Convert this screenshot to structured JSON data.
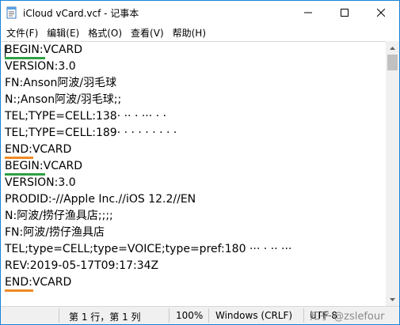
{
  "window": {
    "title": "iCloud vCard.vcf - 记事本"
  },
  "menu": [
    "文件(F)",
    "编辑(E)",
    "格式(O)",
    "查看(V)",
    "帮助(H)"
  ],
  "lines": [
    "BEGIN:VCARD",
    "VERSION:3.0",
    "FN:Anson阿波/羽毛球",
    "N:;Anson阿波/羽毛球;;",
    "TEL;TYPE=CELL:138· ·· · ··· · ·",
    "TEL;TYPE=CELL:189· · · · · · · · ·",
    "END:VCARD",
    "BEGIN:VCARD",
    "VERSION:3.0",
    "PRODID:-//Apple Inc.//iOS 12.2//EN",
    "N:阿波/捞仔渔具店;;;;",
    "FN:阿波/捞仔渔具店",
    "TEL;type=CELL;type=VOICE;type=pref:180   ··· ·  ·· ···",
    "REV:2019-05-17T09:17:34Z",
    "END:VCARD"
  ],
  "status": {
    "position": "第 1 行，第 1 列",
    "zoom": "100%",
    "line_ending": "Windows (CRLF)",
    "encoding": "UTF-8"
  },
  "watermark": "知乎 @zslefour",
  "colors": {
    "begin_underline": "#2ea043",
    "end_underline": "#f08a24",
    "window_border": "#1883d7"
  }
}
